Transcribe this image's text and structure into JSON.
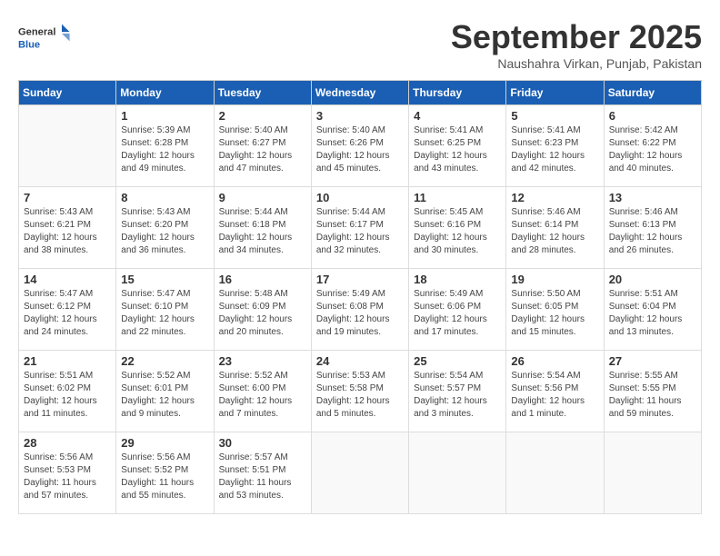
{
  "header": {
    "logo_line1": "General",
    "logo_line2": "Blue",
    "month_title": "September 2025",
    "subtitle": "Naushahra Virkan, Punjab, Pakistan"
  },
  "weekdays": [
    "Sunday",
    "Monday",
    "Tuesday",
    "Wednesday",
    "Thursday",
    "Friday",
    "Saturday"
  ],
  "weeks": [
    [
      {
        "day": "",
        "info": ""
      },
      {
        "day": "1",
        "info": "Sunrise: 5:39 AM\nSunset: 6:28 PM\nDaylight: 12 hours\nand 49 minutes."
      },
      {
        "day": "2",
        "info": "Sunrise: 5:40 AM\nSunset: 6:27 PM\nDaylight: 12 hours\nand 47 minutes."
      },
      {
        "day": "3",
        "info": "Sunrise: 5:40 AM\nSunset: 6:26 PM\nDaylight: 12 hours\nand 45 minutes."
      },
      {
        "day": "4",
        "info": "Sunrise: 5:41 AM\nSunset: 6:25 PM\nDaylight: 12 hours\nand 43 minutes."
      },
      {
        "day": "5",
        "info": "Sunrise: 5:41 AM\nSunset: 6:23 PM\nDaylight: 12 hours\nand 42 minutes."
      },
      {
        "day": "6",
        "info": "Sunrise: 5:42 AM\nSunset: 6:22 PM\nDaylight: 12 hours\nand 40 minutes."
      }
    ],
    [
      {
        "day": "7",
        "info": "Sunrise: 5:43 AM\nSunset: 6:21 PM\nDaylight: 12 hours\nand 38 minutes."
      },
      {
        "day": "8",
        "info": "Sunrise: 5:43 AM\nSunset: 6:20 PM\nDaylight: 12 hours\nand 36 minutes."
      },
      {
        "day": "9",
        "info": "Sunrise: 5:44 AM\nSunset: 6:18 PM\nDaylight: 12 hours\nand 34 minutes."
      },
      {
        "day": "10",
        "info": "Sunrise: 5:44 AM\nSunset: 6:17 PM\nDaylight: 12 hours\nand 32 minutes."
      },
      {
        "day": "11",
        "info": "Sunrise: 5:45 AM\nSunset: 6:16 PM\nDaylight: 12 hours\nand 30 minutes."
      },
      {
        "day": "12",
        "info": "Sunrise: 5:46 AM\nSunset: 6:14 PM\nDaylight: 12 hours\nand 28 minutes."
      },
      {
        "day": "13",
        "info": "Sunrise: 5:46 AM\nSunset: 6:13 PM\nDaylight: 12 hours\nand 26 minutes."
      }
    ],
    [
      {
        "day": "14",
        "info": "Sunrise: 5:47 AM\nSunset: 6:12 PM\nDaylight: 12 hours\nand 24 minutes."
      },
      {
        "day": "15",
        "info": "Sunrise: 5:47 AM\nSunset: 6:10 PM\nDaylight: 12 hours\nand 22 minutes."
      },
      {
        "day": "16",
        "info": "Sunrise: 5:48 AM\nSunset: 6:09 PM\nDaylight: 12 hours\nand 20 minutes."
      },
      {
        "day": "17",
        "info": "Sunrise: 5:49 AM\nSunset: 6:08 PM\nDaylight: 12 hours\nand 19 minutes."
      },
      {
        "day": "18",
        "info": "Sunrise: 5:49 AM\nSunset: 6:06 PM\nDaylight: 12 hours\nand 17 minutes."
      },
      {
        "day": "19",
        "info": "Sunrise: 5:50 AM\nSunset: 6:05 PM\nDaylight: 12 hours\nand 15 minutes."
      },
      {
        "day": "20",
        "info": "Sunrise: 5:51 AM\nSunset: 6:04 PM\nDaylight: 12 hours\nand 13 minutes."
      }
    ],
    [
      {
        "day": "21",
        "info": "Sunrise: 5:51 AM\nSunset: 6:02 PM\nDaylight: 12 hours\nand 11 minutes."
      },
      {
        "day": "22",
        "info": "Sunrise: 5:52 AM\nSunset: 6:01 PM\nDaylight: 12 hours\nand 9 minutes."
      },
      {
        "day": "23",
        "info": "Sunrise: 5:52 AM\nSunset: 6:00 PM\nDaylight: 12 hours\nand 7 minutes."
      },
      {
        "day": "24",
        "info": "Sunrise: 5:53 AM\nSunset: 5:58 PM\nDaylight: 12 hours\nand 5 minutes."
      },
      {
        "day": "25",
        "info": "Sunrise: 5:54 AM\nSunset: 5:57 PM\nDaylight: 12 hours\nand 3 minutes."
      },
      {
        "day": "26",
        "info": "Sunrise: 5:54 AM\nSunset: 5:56 PM\nDaylight: 12 hours\nand 1 minute."
      },
      {
        "day": "27",
        "info": "Sunrise: 5:55 AM\nSunset: 5:55 PM\nDaylight: 11 hours\nand 59 minutes."
      }
    ],
    [
      {
        "day": "28",
        "info": "Sunrise: 5:56 AM\nSunset: 5:53 PM\nDaylight: 11 hours\nand 57 minutes."
      },
      {
        "day": "29",
        "info": "Sunrise: 5:56 AM\nSunset: 5:52 PM\nDaylight: 11 hours\nand 55 minutes."
      },
      {
        "day": "30",
        "info": "Sunrise: 5:57 AM\nSunset: 5:51 PM\nDaylight: 11 hours\nand 53 minutes."
      },
      {
        "day": "",
        "info": ""
      },
      {
        "day": "",
        "info": ""
      },
      {
        "day": "",
        "info": ""
      },
      {
        "day": "",
        "info": ""
      }
    ]
  ]
}
